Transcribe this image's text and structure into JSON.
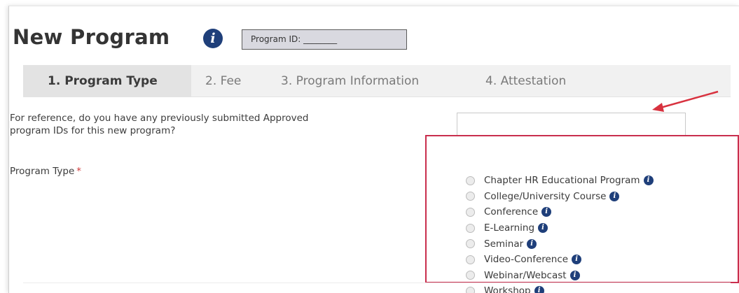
{
  "header": {
    "title": "New Program",
    "info_icon": "i",
    "program_id_label": "Program ID: ________"
  },
  "tabs": [
    {
      "label": "1. Program Type",
      "active": true
    },
    {
      "label": "2. Fee",
      "active": false
    },
    {
      "label": "3. Program Information",
      "active": false
    },
    {
      "label": "4. Attestation",
      "active": false
    }
  ],
  "reference_question": {
    "line1": "For reference, do you have any previously submitted Approved",
    "line2": "program IDs for this new program?"
  },
  "program_type": {
    "label": "Program Type",
    "required_mark": "*",
    "options": [
      {
        "label": "Chapter HR Educational Program",
        "info": "i"
      },
      {
        "label": "College/University Course",
        "info": "i"
      },
      {
        "label": "Conference",
        "info": "i"
      },
      {
        "label": "E-Learning",
        "info": "i"
      },
      {
        "label": "Seminar",
        "info": "i"
      },
      {
        "label": "Video-Conference",
        "info": "i"
      },
      {
        "label": "Webinar/Webcast",
        "info": "i"
      },
      {
        "label": "Workshop",
        "info": "i"
      }
    ]
  },
  "colors": {
    "info_icon": "#1f3f7a",
    "annotation": "#c92e4d",
    "required": "#d03b3b"
  },
  "icons": {
    "info": "info-circle-icon",
    "radio": "radio-button-icon",
    "arrow": "annotation-arrow-icon"
  }
}
